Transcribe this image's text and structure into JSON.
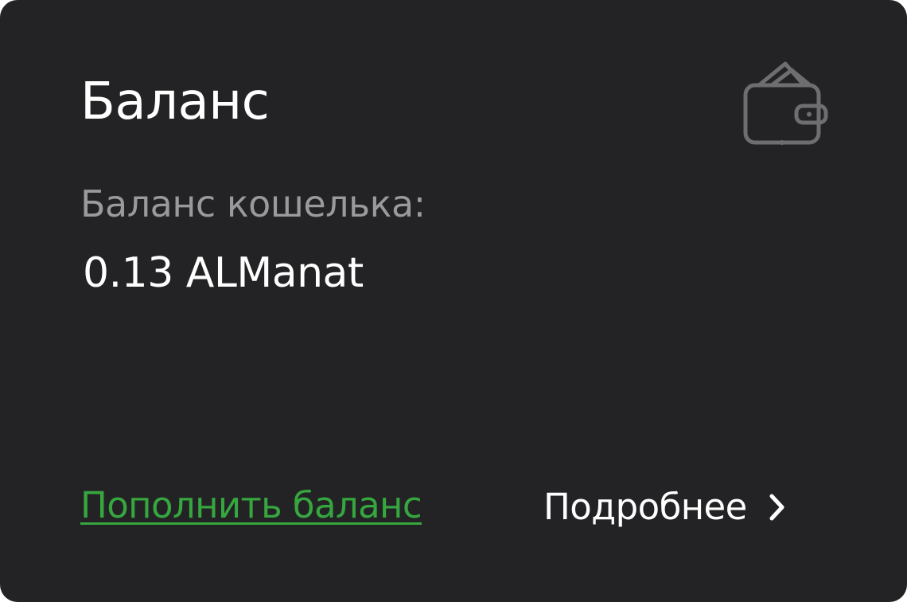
{
  "card": {
    "title": "Баланс",
    "icon": "wallet-icon",
    "balance_label": "Баланс кошелька:",
    "balance_amount": "0.13 ALManat",
    "topup_label": "Пополнить баланс",
    "details_label": "Подробнее",
    "details_icon": "chevron-right-icon"
  },
  "colors": {
    "card_background": "#232325",
    "title": "#ffffff",
    "muted_text": "#9a9a9c",
    "icon": "#6e6e70",
    "accent_link": "#36a63f"
  }
}
